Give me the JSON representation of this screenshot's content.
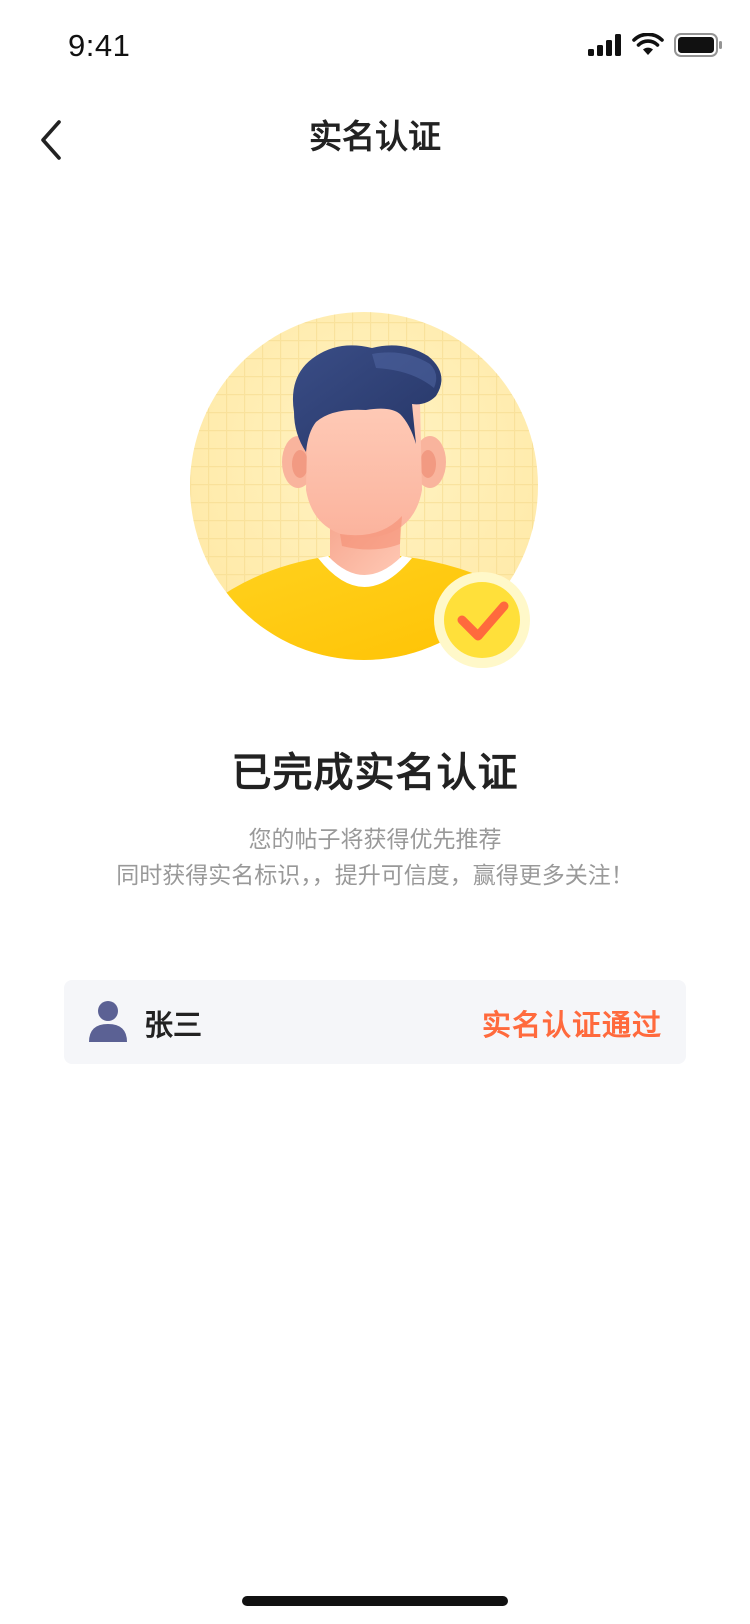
{
  "status_bar": {
    "time": "9:41",
    "icons": [
      "signal-icon",
      "wifi-icon",
      "battery-icon"
    ]
  },
  "nav": {
    "back_icon": "chevron-left-icon",
    "title": "实名认证"
  },
  "result": {
    "title": "已完成实名认证",
    "line1": "您的帖子将获得优先推荐",
    "line2": "同时获得实名标识，，提升可信度，赢得更多关注！"
  },
  "card": {
    "user_icon": "user-icon",
    "name": "张三",
    "status": "实名认证通过"
  },
  "colors": {
    "accent": "#ff6a3d",
    "card_bg": "#f5f6f9",
    "badge_yellow": "#ffe03a",
    "shirt_yellow": "#ffd21f",
    "hair_navy": "#2f4075",
    "user_icon": "#5b6194"
  }
}
